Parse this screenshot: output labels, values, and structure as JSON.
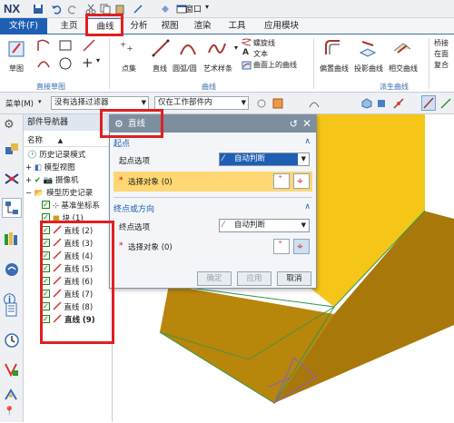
{
  "app": {
    "logo": "NX",
    "window_menu": "窗口"
  },
  "ribbon_tabs": [
    "文件(F)",
    "主页",
    "曲线",
    "分析",
    "视图",
    "渲染",
    "工具",
    "应用模块"
  ],
  "ribbon": {
    "sketch_label": "草图",
    "group_direct_sketch": "直接草图",
    "point_set": "点集",
    "line": "直线",
    "arc_circle": "圆弧/圆",
    "art_spline": "艺术样条",
    "group_curve": "曲线",
    "helix": "螺旋线",
    "text": "文本",
    "curve_on_surface": "曲面上的曲线",
    "offset_curve": "偏置曲线",
    "project_curve": "投影曲线",
    "intersect_curve": "相交曲线",
    "group_derived": "派生曲线",
    "bridge": "桥接",
    "in_face": "在面",
    "composite": "复合"
  },
  "filterbar": {
    "menu": "菜单(M)",
    "filter_value": "没有选择过滤器",
    "scope_value": "仅在工作部件内"
  },
  "navigator": {
    "title": "部件导航器",
    "col_name": "名称",
    "items": [
      {
        "label": "历史记录模式"
      },
      {
        "label": "模型视图"
      },
      {
        "label": "摄像机"
      },
      {
        "label": "模型历史记录"
      },
      {
        "label": "基准坐标系"
      },
      {
        "label": "块 (1)"
      },
      {
        "label": "直线 (2)"
      },
      {
        "label": "直线 (3)"
      },
      {
        "label": "直线 (4)"
      },
      {
        "label": "直线 (5)"
      },
      {
        "label": "直线 (6)"
      },
      {
        "label": "直线 (7)"
      },
      {
        "label": "直线 (8)"
      },
      {
        "label": "直线 (9)"
      }
    ]
  },
  "dialog": {
    "title": "直线",
    "start_section": "起点",
    "start_option_label": "起点选项",
    "start_option_value": "自动判断",
    "start_select": "选择对象 (0)",
    "end_section": "终点或方向",
    "end_option_label": "终点选项",
    "end_option_value": "自动判断",
    "end_select": "选择对象 (0)",
    "ok": "确定",
    "apply": "应用",
    "cancel": "取消"
  },
  "colors": {
    "accent": "#1e5fb4",
    "block_top": "#f5c518",
    "block_side": "#b8860b",
    "annotation": "#e02020",
    "highlight_row": "#ffd773"
  }
}
